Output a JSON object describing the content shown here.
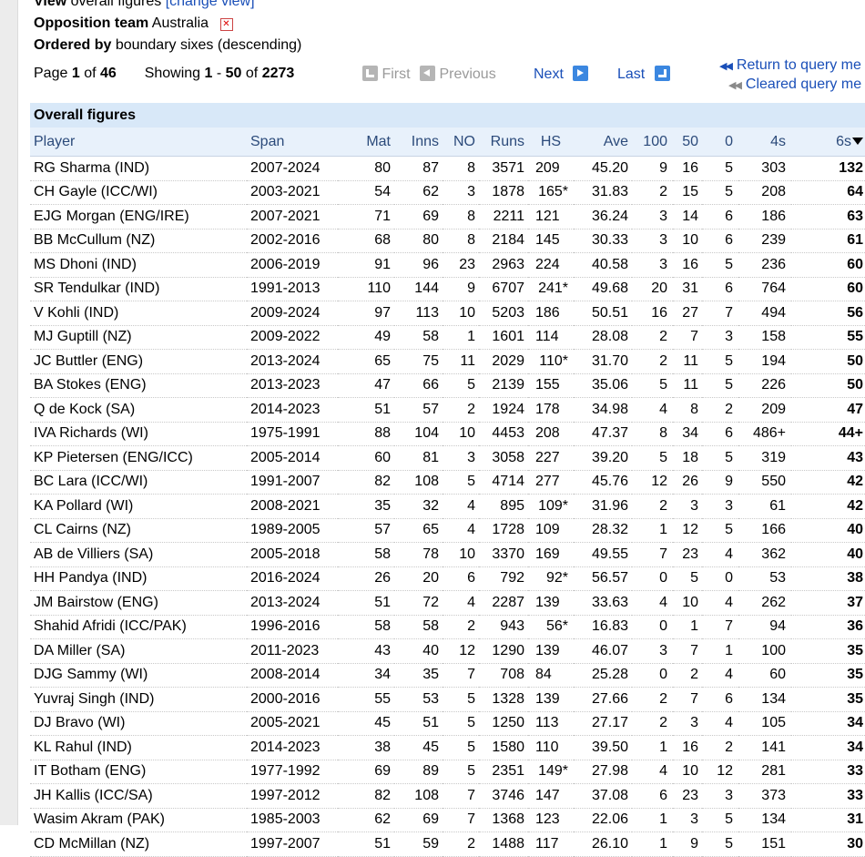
{
  "filters": {
    "view_label": "View",
    "view_value": "overall figures",
    "change_view": "[change view]",
    "opposition_label": "Opposition team",
    "opposition_value": "Australia",
    "ordered_label": "Ordered by",
    "ordered_value": "boundary sixes (descending)"
  },
  "pager": {
    "page_word": "Page",
    "page": "1",
    "of_word": "of",
    "total_pages": "46",
    "showing_word": "Showing",
    "from": "1",
    "dash": "-",
    "to": "50",
    "of_word2": "of",
    "total_rows": "2273"
  },
  "nav": {
    "first": "First",
    "previous": "Previous",
    "next": "Next",
    "last": "Last",
    "return_query": "Return to query me",
    "cleared_query": "Cleared query me"
  },
  "table": {
    "caption": "Overall figures",
    "headers": [
      "Player",
      "Span",
      "Mat",
      "Inns",
      "NO",
      "Runs",
      "HS",
      "Ave",
      "100",
      "50",
      "0",
      "4s",
      "6s"
    ],
    "rows": [
      [
        "RG Sharma (IND)",
        "2007-2024",
        "80",
        "87",
        "8",
        "3571",
        "209",
        "45.20",
        "9",
        "16",
        "5",
        "303",
        "132"
      ],
      [
        "CH Gayle (ICC/WI)",
        "2003-2021",
        "54",
        "62",
        "3",
        "1878",
        "165*",
        "31.83",
        "2",
        "15",
        "5",
        "208",
        "64"
      ],
      [
        "EJG Morgan (ENG/IRE)",
        "2007-2021",
        "71",
        "69",
        "8",
        "2211",
        "121",
        "36.24",
        "3",
        "14",
        "6",
        "186",
        "63"
      ],
      [
        "BB McCullum (NZ)",
        "2002-2016",
        "68",
        "80",
        "8",
        "2184",
        "145",
        "30.33",
        "3",
        "10",
        "6",
        "239",
        "61"
      ],
      [
        "MS Dhoni (IND)",
        "2006-2019",
        "91",
        "96",
        "23",
        "2963",
        "224",
        "40.58",
        "3",
        "16",
        "5",
        "236",
        "60"
      ],
      [
        "SR Tendulkar (IND)",
        "1991-2013",
        "110",
        "144",
        "9",
        "6707",
        "241*",
        "49.68",
        "20",
        "31",
        "6",
        "764",
        "60"
      ],
      [
        "V Kohli (IND)",
        "2009-2024",
        "97",
        "113",
        "10",
        "5203",
        "186",
        "50.51",
        "16",
        "27",
        "7",
        "494",
        "56"
      ],
      [
        "MJ Guptill (NZ)",
        "2009-2022",
        "49",
        "58",
        "1",
        "1601",
        "114",
        "28.08",
        "2",
        "7",
        "3",
        "158",
        "55"
      ],
      [
        "JC Buttler (ENG)",
        "2013-2024",
        "65",
        "75",
        "11",
        "2029",
        "110*",
        "31.70",
        "2",
        "11",
        "5",
        "194",
        "50"
      ],
      [
        "BA Stokes (ENG)",
        "2013-2023",
        "47",
        "66",
        "5",
        "2139",
        "155",
        "35.06",
        "5",
        "11",
        "5",
        "226",
        "50"
      ],
      [
        "Q de Kock (SA)",
        "2014-2023",
        "51",
        "57",
        "2",
        "1924",
        "178",
        "34.98",
        "4",
        "8",
        "2",
        "209",
        "47"
      ],
      [
        "IVA Richards (WI)",
        "1975-1991",
        "88",
        "104",
        "10",
        "4453",
        "208",
        "47.37",
        "8",
        "34",
        "6",
        "486+",
        "44+"
      ],
      [
        "KP Pietersen (ENG/ICC)",
        "2005-2014",
        "60",
        "81",
        "3",
        "3058",
        "227",
        "39.20",
        "5",
        "18",
        "5",
        "319",
        "43"
      ],
      [
        "BC Lara (ICC/WI)",
        "1991-2007",
        "82",
        "108",
        "5",
        "4714",
        "277",
        "45.76",
        "12",
        "26",
        "9",
        "550",
        "42"
      ],
      [
        "KA Pollard (WI)",
        "2008-2021",
        "35",
        "32",
        "4",
        "895",
        "109*",
        "31.96",
        "2",
        "3",
        "3",
        "61",
        "42"
      ],
      [
        "CL Cairns (NZ)",
        "1989-2005",
        "57",
        "65",
        "4",
        "1728",
        "109",
        "28.32",
        "1",
        "12",
        "5",
        "166",
        "40"
      ],
      [
        "AB de Villiers (SA)",
        "2005-2018",
        "58",
        "78",
        "10",
        "3370",
        "169",
        "49.55",
        "7",
        "23",
        "4",
        "362",
        "40"
      ],
      [
        "HH Pandya (IND)",
        "2016-2024",
        "26",
        "20",
        "6",
        "792",
        "92*",
        "56.57",
        "0",
        "5",
        "0",
        "53",
        "38"
      ],
      [
        "JM Bairstow (ENG)",
        "2013-2024",
        "51",
        "72",
        "4",
        "2287",
        "139",
        "33.63",
        "4",
        "10",
        "4",
        "262",
        "37"
      ],
      [
        "Shahid Afridi (ICC/PAK)",
        "1996-2016",
        "58",
        "58",
        "2",
        "943",
        "56*",
        "16.83",
        "0",
        "1",
        "7",
        "94",
        "36"
      ],
      [
        "DA Miller (SA)",
        "2011-2023",
        "43",
        "40",
        "12",
        "1290",
        "139",
        "46.07",
        "3",
        "7",
        "1",
        "100",
        "35"
      ],
      [
        "DJG Sammy (WI)",
        "2008-2014",
        "34",
        "35",
        "7",
        "708",
        "84",
        "25.28",
        "0",
        "2",
        "4",
        "60",
        "35"
      ],
      [
        "Yuvraj Singh (IND)",
        "2000-2016",
        "55",
        "53",
        "5",
        "1328",
        "139",
        "27.66",
        "2",
        "7",
        "6",
        "134",
        "35"
      ],
      [
        "DJ Bravo (WI)",
        "2005-2021",
        "45",
        "51",
        "5",
        "1250",
        "113",
        "27.17",
        "2",
        "3",
        "4",
        "105",
        "34"
      ],
      [
        "KL Rahul (IND)",
        "2014-2023",
        "38",
        "45",
        "5",
        "1580",
        "110",
        "39.50",
        "1",
        "16",
        "2",
        "141",
        "34"
      ],
      [
        "IT Botham (ENG)",
        "1977-1992",
        "69",
        "89",
        "5",
        "2351",
        "149*",
        "27.98",
        "4",
        "10",
        "12",
        "281",
        "33"
      ],
      [
        "JH Kallis (ICC/SA)",
        "1997-2012",
        "82",
        "108",
        "7",
        "3746",
        "147",
        "37.08",
        "6",
        "23",
        "3",
        "373",
        "33"
      ],
      [
        "Wasim Akram (PAK)",
        "1985-2003",
        "62",
        "69",
        "7",
        "1368",
        "123",
        "22.06",
        "1",
        "3",
        "5",
        "134",
        "31"
      ],
      [
        "CD McMillan (NZ)",
        "1997-2007",
        "51",
        "59",
        "2",
        "1488",
        "117",
        "26.10",
        "1",
        "9",
        "5",
        "151",
        "30"
      ]
    ]
  }
}
